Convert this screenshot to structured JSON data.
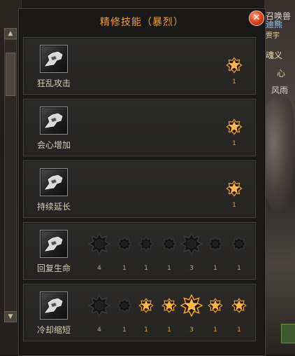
{
  "window": {
    "title": "精修技能（暴烈）",
    "close_label": "✕"
  },
  "background": {
    "right_texts": [
      "召唤兽",
      "迪熊",
      "贾宇",
      "魂义",
      "心",
      "风雨"
    ],
    "left_scroll_up": "▲",
    "left_scroll_down": "▼"
  },
  "skills": [
    {
      "name": "狂乱攻击",
      "type": "single",
      "level": "1",
      "icon": "fist-icon"
    },
    {
      "name": "会心增加",
      "type": "single",
      "level": "1",
      "icon": "fist-icon"
    },
    {
      "name": "持续延长",
      "type": "single",
      "level": "1",
      "icon": "fist-icon"
    },
    {
      "name": "回复生命",
      "type": "multi",
      "icon": "fist-icon",
      "nodes": [
        {
          "level": "4",
          "size": "big",
          "active": false
        },
        {
          "level": "1",
          "size": "small",
          "active": false
        },
        {
          "level": "1",
          "size": "small",
          "active": false
        },
        {
          "level": "1",
          "size": "small",
          "active": false
        },
        {
          "level": "3",
          "size": "big",
          "active": false
        },
        {
          "level": "1",
          "size": "small",
          "active": false
        },
        {
          "level": "1",
          "size": "small",
          "active": false
        }
      ]
    },
    {
      "name": "冷却缩短",
      "type": "multi",
      "icon": "fist-icon",
      "nodes": [
        {
          "level": "4",
          "size": "big",
          "active": false
        },
        {
          "level": "1",
          "size": "small",
          "active": false
        },
        {
          "level": "1",
          "size": "small",
          "active": true
        },
        {
          "level": "1",
          "size": "small",
          "active": true
        },
        {
          "level": "3",
          "size": "big",
          "active": true
        },
        {
          "level": "1",
          "size": "small",
          "active": true
        },
        {
          "level": "1",
          "size": "small",
          "active": true
        }
      ]
    }
  ],
  "colors": {
    "title": "#f0a13a",
    "active_star": "#f2a22a",
    "inactive_node": "#1a1a1a"
  }
}
